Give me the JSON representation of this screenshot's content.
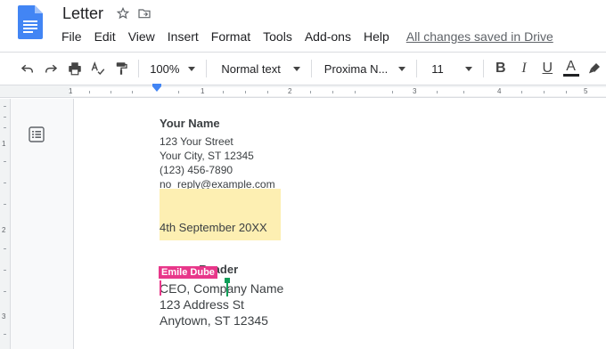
{
  "app": {
    "doc_title": "Letter",
    "saved_status": "All changes saved in Drive",
    "accent_color": "#4285f4"
  },
  "menu": [
    "File",
    "Edit",
    "View",
    "Insert",
    "Format",
    "Tools",
    "Add-ons",
    "Help"
  ],
  "toolbar": {
    "zoom": "100%",
    "style": "Normal text",
    "font": "Proxima N...",
    "size": "11",
    "bold": "B",
    "italic": "I",
    "underline": "U",
    "text_color": "A"
  },
  "ruler": {
    "numbers": [
      "1",
      "1",
      "2",
      "3",
      "4",
      "5"
    ]
  },
  "vruler": {
    "numbers": [
      "1",
      "2",
      "3"
    ]
  },
  "document": {
    "sender_name": "Your Name",
    "street": "123 Your Street",
    "city": "Your City, ST 12345",
    "phone": "(123) 456-7890",
    "email": "no_reply@example.com",
    "date": "4th September 20XX",
    "recipient_partial": "Ronny Reader",
    "recipient_visible": "Reader",
    "recipient_title": "CEO, Company Name",
    "recipient_street": "123 Address St",
    "recipient_city": "Anytown, ST 12345"
  },
  "collaborators": {
    "pink_name": "Emile Dube",
    "pink_color": "#e8378a",
    "green_color": "#0f9d58"
  },
  "highlight_color": "#fdefb2"
}
